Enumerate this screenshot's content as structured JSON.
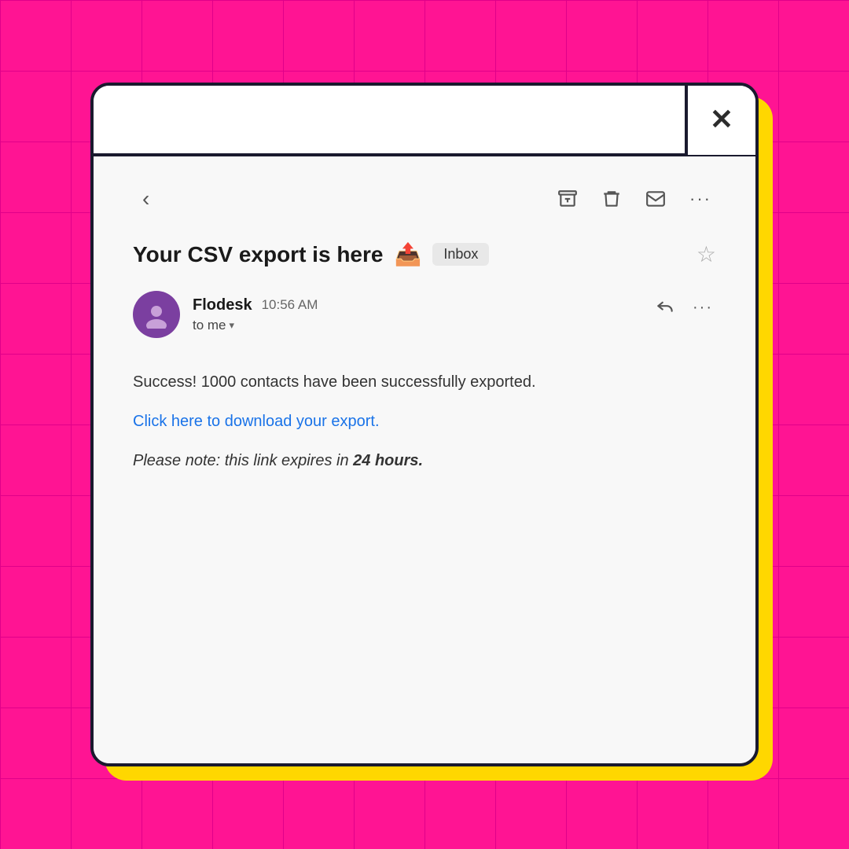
{
  "background": {
    "color": "#FF1493",
    "grid_color": "#e0008a"
  },
  "window": {
    "close_button_label": "✕"
  },
  "toolbar": {
    "back_label": "‹",
    "more_label": "···"
  },
  "email": {
    "subject": "Your CSV export is here",
    "subject_emoji": "📤",
    "inbox_badge": "Inbox",
    "sender_name": "Flodesk",
    "sender_time": "10:56 AM",
    "to_me_label": "to me",
    "body_line1": "Success! 1000 contacts have been successfully exported.",
    "download_link_text": "Click here to download your export.",
    "note_text": "Please note: this link expires in ",
    "note_bold": "24 hours."
  }
}
